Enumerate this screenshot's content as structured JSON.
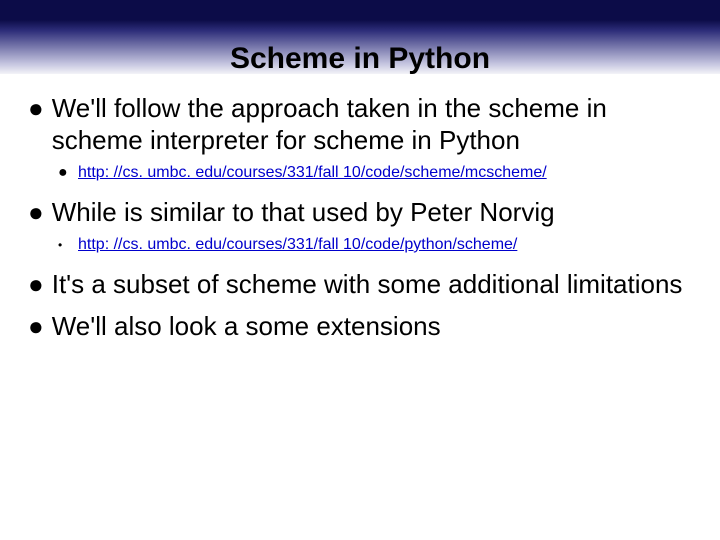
{
  "title": "Scheme in Python",
  "bullets": {
    "b1": "We'll follow the approach taken in the scheme in scheme interpreter for scheme in Python",
    "b1_link": "http: //cs. umbc. edu/courses/331/fall 10/code/scheme/mcscheme/",
    "b2": "While is similar to that used by Peter Norvig",
    "b2_link": "http: //cs. umbc. edu/courses/331/fall 10/code/python/scheme/",
    "b3": "It's a subset of scheme with some additional limitations",
    "b4": "We'll also look a some extensions"
  }
}
